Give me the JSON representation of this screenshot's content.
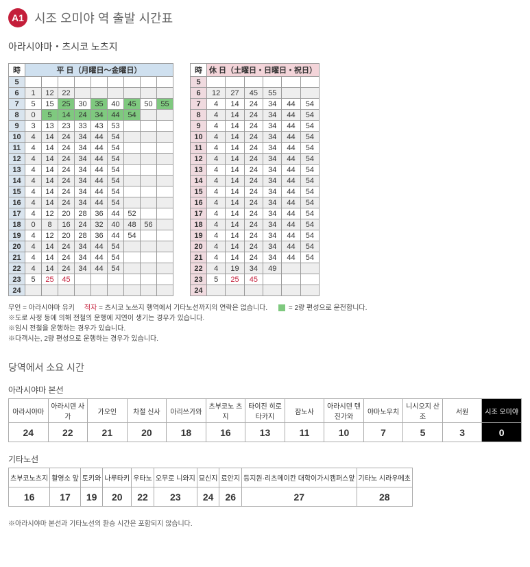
{
  "badge": "A1",
  "title": "시조 오미야 역 출발 시간표",
  "subtitle": "아라시야마・츠시코 노츠지",
  "weekday_header": "平 日（月曜日～金曜日）",
  "weekend_header": "休 日（土曜日・日曜日・祝日）",
  "hour_label": "時",
  "weekday": [
    {
      "h": 5,
      "m": []
    },
    {
      "h": 6,
      "m": [
        {
          "v": "1"
        },
        {
          "v": "12"
        },
        {
          "v": "22"
        }
      ]
    },
    {
      "h": 7,
      "m": [
        {
          "v": "5"
        },
        {
          "v": "15"
        },
        {
          "v": "25",
          "g": true
        },
        {
          "v": "30"
        },
        {
          "v": "35",
          "g": true
        },
        {
          "v": "40"
        },
        {
          "v": "45",
          "g": true
        },
        {
          "v": "50"
        },
        {
          "v": "55",
          "g": true
        }
      ]
    },
    {
      "h": 8,
      "m": [
        {
          "v": "0"
        },
        {
          "v": "5",
          "g": true
        },
        {
          "v": "14",
          "g": true
        },
        {
          "v": "24",
          "g": true
        },
        {
          "v": "34",
          "g": true
        },
        {
          "v": "44",
          "g": true
        },
        {
          "v": "54",
          "g": true
        }
      ]
    },
    {
      "h": 9,
      "m": [
        {
          "v": "3"
        },
        {
          "v": "13"
        },
        {
          "v": "23"
        },
        {
          "v": "33"
        },
        {
          "v": "43"
        },
        {
          "v": "53"
        }
      ]
    },
    {
      "h": 10,
      "m": [
        {
          "v": "4"
        },
        {
          "v": "14"
        },
        {
          "v": "24"
        },
        {
          "v": "34"
        },
        {
          "v": "44"
        },
        {
          "v": "54"
        }
      ]
    },
    {
      "h": 11,
      "m": [
        {
          "v": "4"
        },
        {
          "v": "14"
        },
        {
          "v": "24"
        },
        {
          "v": "34"
        },
        {
          "v": "44"
        },
        {
          "v": "54"
        }
      ]
    },
    {
      "h": 12,
      "m": [
        {
          "v": "4"
        },
        {
          "v": "14"
        },
        {
          "v": "24"
        },
        {
          "v": "34"
        },
        {
          "v": "44"
        },
        {
          "v": "54"
        }
      ]
    },
    {
      "h": 13,
      "m": [
        {
          "v": "4"
        },
        {
          "v": "14"
        },
        {
          "v": "24"
        },
        {
          "v": "34"
        },
        {
          "v": "44"
        },
        {
          "v": "54"
        }
      ]
    },
    {
      "h": 14,
      "m": [
        {
          "v": "4"
        },
        {
          "v": "14"
        },
        {
          "v": "24"
        },
        {
          "v": "34"
        },
        {
          "v": "44"
        },
        {
          "v": "54"
        }
      ]
    },
    {
      "h": 15,
      "m": [
        {
          "v": "4"
        },
        {
          "v": "14"
        },
        {
          "v": "24"
        },
        {
          "v": "34"
        },
        {
          "v": "44"
        },
        {
          "v": "54"
        }
      ]
    },
    {
      "h": 16,
      "m": [
        {
          "v": "4"
        },
        {
          "v": "14"
        },
        {
          "v": "24"
        },
        {
          "v": "34"
        },
        {
          "v": "44"
        },
        {
          "v": "54"
        }
      ]
    },
    {
      "h": 17,
      "m": [
        {
          "v": "4"
        },
        {
          "v": "12"
        },
        {
          "v": "20"
        },
        {
          "v": "28"
        },
        {
          "v": "36"
        },
        {
          "v": "44"
        },
        {
          "v": "52"
        }
      ]
    },
    {
      "h": 18,
      "m": [
        {
          "v": "0"
        },
        {
          "v": "8"
        },
        {
          "v": "16"
        },
        {
          "v": "24"
        },
        {
          "v": "32"
        },
        {
          "v": "40"
        },
        {
          "v": "48"
        },
        {
          "v": "56"
        }
      ]
    },
    {
      "h": 19,
      "m": [
        {
          "v": "4"
        },
        {
          "v": "12"
        },
        {
          "v": "20"
        },
        {
          "v": "28"
        },
        {
          "v": "36"
        },
        {
          "v": "44"
        },
        {
          "v": "54"
        }
      ]
    },
    {
      "h": 20,
      "m": [
        {
          "v": "4"
        },
        {
          "v": "14"
        },
        {
          "v": "24"
        },
        {
          "v": "34"
        },
        {
          "v": "44"
        },
        {
          "v": "54"
        }
      ]
    },
    {
      "h": 21,
      "m": [
        {
          "v": "4"
        },
        {
          "v": "14"
        },
        {
          "v": "24"
        },
        {
          "v": "34"
        },
        {
          "v": "44"
        },
        {
          "v": "54"
        }
      ]
    },
    {
      "h": 22,
      "m": [
        {
          "v": "4"
        },
        {
          "v": "14"
        },
        {
          "v": "24"
        },
        {
          "v": "34"
        },
        {
          "v": "44"
        },
        {
          "v": "54"
        }
      ]
    },
    {
      "h": 23,
      "m": [
        {
          "v": "5"
        },
        {
          "v": "25",
          "r": true
        },
        {
          "v": "45",
          "r": true
        }
      ]
    },
    {
      "h": 24,
      "m": []
    }
  ],
  "weekend": [
    {
      "h": 5,
      "m": []
    },
    {
      "h": 6,
      "m": [
        {
          "v": "12"
        },
        {
          "v": "27"
        },
        {
          "v": "45"
        },
        {
          "v": "55"
        }
      ]
    },
    {
      "h": 7,
      "m": [
        {
          "v": "4"
        },
        {
          "v": "14"
        },
        {
          "v": "24"
        },
        {
          "v": "34"
        },
        {
          "v": "44"
        },
        {
          "v": "54"
        }
      ]
    },
    {
      "h": 8,
      "m": [
        {
          "v": "4"
        },
        {
          "v": "14"
        },
        {
          "v": "24"
        },
        {
          "v": "34"
        },
        {
          "v": "44"
        },
        {
          "v": "54"
        }
      ]
    },
    {
      "h": 9,
      "m": [
        {
          "v": "4"
        },
        {
          "v": "14"
        },
        {
          "v": "24"
        },
        {
          "v": "34"
        },
        {
          "v": "44"
        },
        {
          "v": "54"
        }
      ]
    },
    {
      "h": 10,
      "m": [
        {
          "v": "4"
        },
        {
          "v": "14"
        },
        {
          "v": "24"
        },
        {
          "v": "34"
        },
        {
          "v": "44"
        },
        {
          "v": "54"
        }
      ]
    },
    {
      "h": 11,
      "m": [
        {
          "v": "4"
        },
        {
          "v": "14"
        },
        {
          "v": "24"
        },
        {
          "v": "34"
        },
        {
          "v": "44"
        },
        {
          "v": "54"
        }
      ]
    },
    {
      "h": 12,
      "m": [
        {
          "v": "4"
        },
        {
          "v": "14"
        },
        {
          "v": "24"
        },
        {
          "v": "34"
        },
        {
          "v": "44"
        },
        {
          "v": "54"
        }
      ]
    },
    {
      "h": 13,
      "m": [
        {
          "v": "4"
        },
        {
          "v": "14"
        },
        {
          "v": "24"
        },
        {
          "v": "34"
        },
        {
          "v": "44"
        },
        {
          "v": "54"
        }
      ]
    },
    {
      "h": 14,
      "m": [
        {
          "v": "4"
        },
        {
          "v": "14"
        },
        {
          "v": "24"
        },
        {
          "v": "34"
        },
        {
          "v": "44"
        },
        {
          "v": "54"
        }
      ]
    },
    {
      "h": 15,
      "m": [
        {
          "v": "4"
        },
        {
          "v": "14"
        },
        {
          "v": "24"
        },
        {
          "v": "34"
        },
        {
          "v": "44"
        },
        {
          "v": "54"
        }
      ]
    },
    {
      "h": 16,
      "m": [
        {
          "v": "4"
        },
        {
          "v": "14"
        },
        {
          "v": "24"
        },
        {
          "v": "34"
        },
        {
          "v": "44"
        },
        {
          "v": "54"
        }
      ]
    },
    {
      "h": 17,
      "m": [
        {
          "v": "4"
        },
        {
          "v": "14"
        },
        {
          "v": "24"
        },
        {
          "v": "34"
        },
        {
          "v": "44"
        },
        {
          "v": "54"
        }
      ]
    },
    {
      "h": 18,
      "m": [
        {
          "v": "4"
        },
        {
          "v": "14"
        },
        {
          "v": "24"
        },
        {
          "v": "34"
        },
        {
          "v": "44"
        },
        {
          "v": "54"
        }
      ]
    },
    {
      "h": 19,
      "m": [
        {
          "v": "4"
        },
        {
          "v": "14"
        },
        {
          "v": "24"
        },
        {
          "v": "34"
        },
        {
          "v": "44"
        },
        {
          "v": "54"
        }
      ]
    },
    {
      "h": 20,
      "m": [
        {
          "v": "4"
        },
        {
          "v": "14"
        },
        {
          "v": "24"
        },
        {
          "v": "34"
        },
        {
          "v": "44"
        },
        {
          "v": "54"
        }
      ]
    },
    {
      "h": 21,
      "m": [
        {
          "v": "4"
        },
        {
          "v": "14"
        },
        {
          "v": "24"
        },
        {
          "v": "34"
        },
        {
          "v": "44"
        },
        {
          "v": "54"
        }
      ]
    },
    {
      "h": 22,
      "m": [
        {
          "v": "4"
        },
        {
          "v": "19"
        },
        {
          "v": "34"
        },
        {
          "v": "49"
        }
      ]
    },
    {
      "h": 23,
      "m": [
        {
          "v": "5"
        },
        {
          "v": "25",
          "r": true
        },
        {
          "v": "45",
          "r": true
        }
      ]
    },
    {
      "h": 24,
      "m": []
    }
  ],
  "weekday_cols": 9,
  "weekend_cols": 6,
  "legend": {
    "muin": "무인 = 아라시야마 유키",
    "red_label": "적자",
    "red_text": " = 츠시코 노쓰지 행역에서 기타노선까지의 연락은 없습니다.",
    "green_text": " = 2량 편성으로 운전합니다.",
    "note1": "※도로 사정 등에 의해 전철의 운행에 지연이 생기는 경우가 있습니다.",
    "note2": "※임시 전철을 운행하는 경우가 있습니다.",
    "note3": "※다객시는, 2량 편성으로 운행하는 경우가 있습니다."
  },
  "duration_header": "당역에서 소요 시간",
  "main_line_name": "아라시야마 본선",
  "main_line": [
    {
      "name": "아라시야마",
      "min": 24
    },
    {
      "name": "아라시덴 사가",
      "min": 22
    },
    {
      "name": "가오인",
      "min": 21
    },
    {
      "name": "차절 신사",
      "min": 20
    },
    {
      "name": "아리쓰가와",
      "min": 18
    },
    {
      "name": "츠부코노 츠지",
      "min": 16
    },
    {
      "name": "타이진 히로 타카지",
      "min": 13
    },
    {
      "name": "잠노사",
      "min": 11
    },
    {
      "name": "아라시덴 텐진가와",
      "min": 10
    },
    {
      "name": "야마노우치",
      "min": 7
    },
    {
      "name": "니시오지 산조",
      "min": 5
    },
    {
      "name": "서원",
      "min": 3
    },
    {
      "name": "시조 오미야",
      "min": 0,
      "current": true
    }
  ],
  "kitano_name": "기타노선",
  "kitano_line": [
    {
      "name": "츠부코노츠지",
      "min": 16
    },
    {
      "name": "촬영소 앞",
      "min": 17
    },
    {
      "name": "토키와",
      "min": 19
    },
    {
      "name": "나루타키",
      "min": 20
    },
    {
      "name": "우타노",
      "min": 22
    },
    {
      "name": "오무로 니와지",
      "min": 23
    },
    {
      "name": "묘신지",
      "min": 24
    },
    {
      "name": "료안지",
      "min": 26
    },
    {
      "name": "등지원·리츠메이칸 대학이가시캠퍼스앞",
      "min": 27
    },
    {
      "name": "기타노 시라우메초",
      "min": 28
    }
  ],
  "kitano_note": "※아라시야마 본선과 기타노선의 환승 시간은 포함되지 않습니다."
}
